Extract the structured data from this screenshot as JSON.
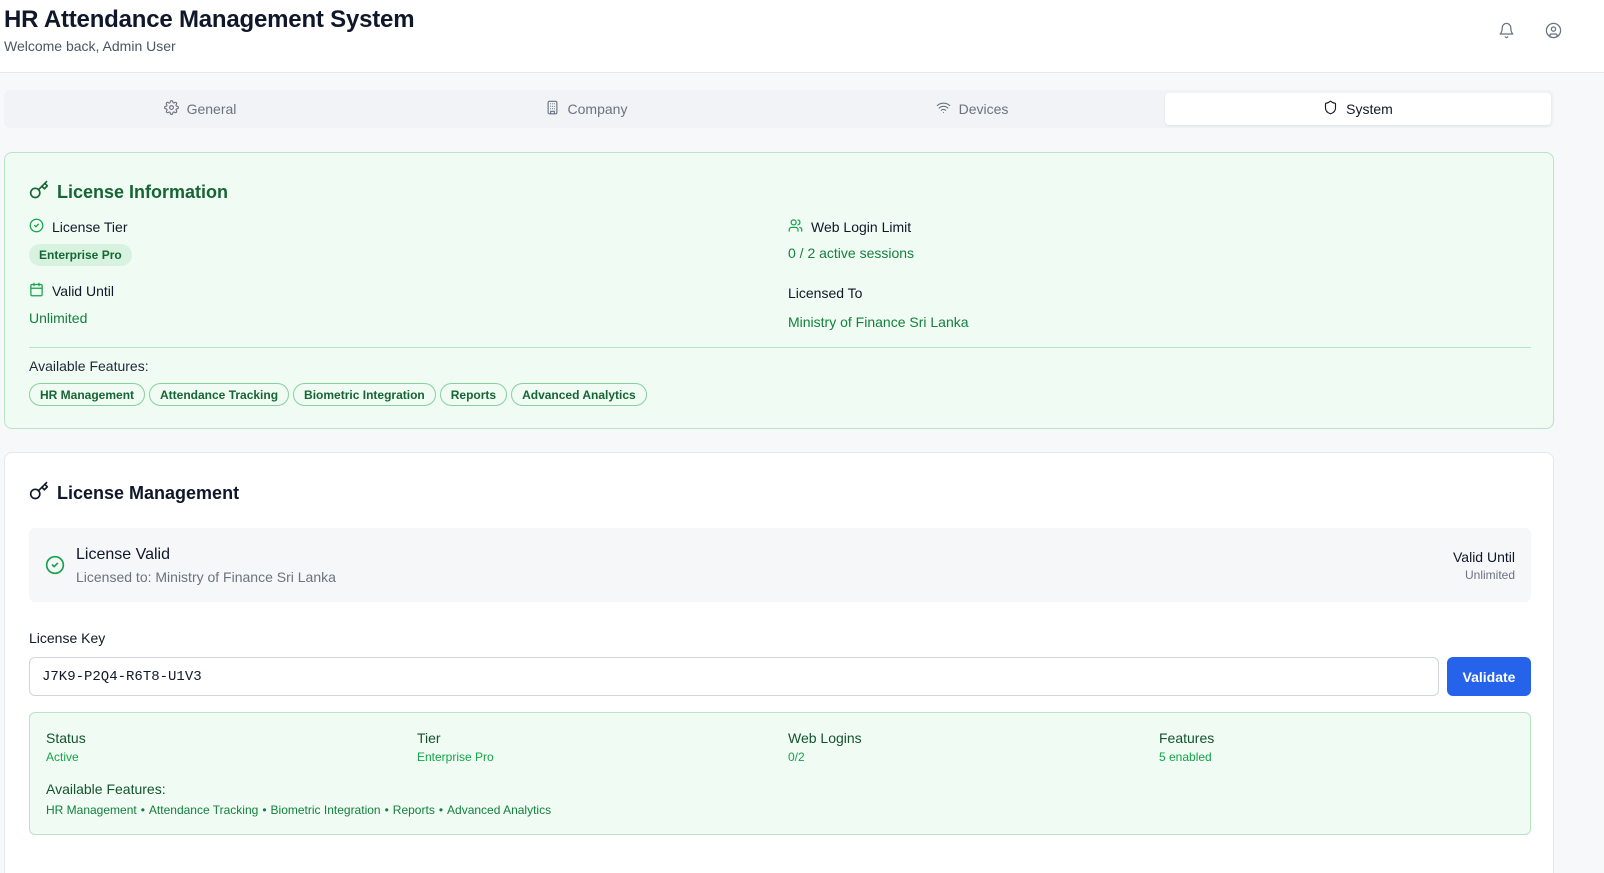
{
  "header": {
    "title": "HR Attendance Management System",
    "welcome": "Welcome back, Admin User",
    "icons": [
      "bell-icon",
      "user-circle-icon"
    ]
  },
  "tabs": [
    {
      "label": "General",
      "icon": "gear-icon",
      "active": false
    },
    {
      "label": "Company",
      "icon": "building-icon",
      "active": false
    },
    {
      "label": "Devices",
      "icon": "wifi-icon",
      "active": false
    },
    {
      "label": "System",
      "icon": "shield-icon",
      "active": true
    }
  ],
  "license_info": {
    "title": "License Information",
    "tier_label": "License Tier",
    "tier_value": "Enterprise Pro",
    "valid_until_label": "Valid Until",
    "valid_until_value": "Unlimited",
    "web_login_label": "Web Login Limit",
    "web_login_value": "0 / 2 active sessions",
    "licensed_to_label": "Licensed To",
    "licensed_to_value": "Ministry of Finance Sri Lanka",
    "features_label": "Available Features:",
    "features": [
      "HR Management",
      "Attendance Tracking",
      "Biometric Integration",
      "Reports",
      "Advanced Analytics"
    ]
  },
  "license_management": {
    "title": "License Management",
    "status_title": "License Valid",
    "status_sub": "Licensed to: Ministry of Finance Sri Lanka",
    "valid_until_label": "Valid Until",
    "valid_until_value": "Unlimited",
    "key_label": "License Key",
    "key_value": "J7K9-P2Q4-R6T8-U1V3",
    "validate_label": "Validate",
    "summary": {
      "status_label": "Status",
      "status_value": "Active",
      "tier_label": "Tier",
      "tier_value": "Enterprise Pro",
      "web_logins_label": "Web Logins",
      "web_logins_value": "0/2",
      "features_label": "Features",
      "features_value": "5 enabled",
      "available_label": "Available Features:",
      "features": [
        "HR Management",
        "Attendance Tracking",
        "Biometric Integration",
        "Reports",
        "Advanced Analytics"
      ],
      "separator": "•"
    }
  },
  "colors": {
    "accent_green": "#16a34a",
    "dark_green": "#166534",
    "button_blue": "#2563eb",
    "green_bg": "#effbf3"
  }
}
